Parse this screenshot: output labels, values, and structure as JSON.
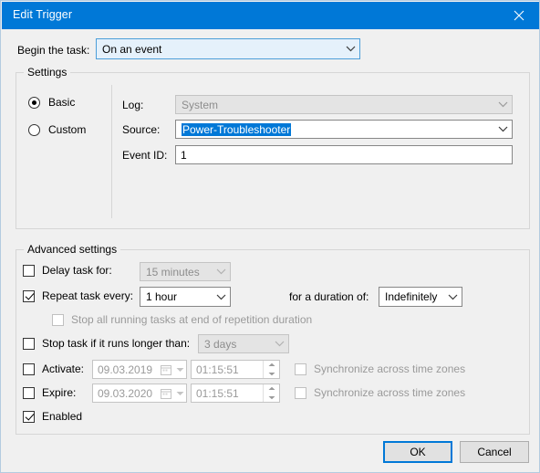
{
  "window": {
    "title": "Edit Trigger",
    "close_icon": "close-icon",
    "titlebar_color": "#0078d7"
  },
  "begin": {
    "label": "Begin the task:",
    "value": "On an event"
  },
  "settings": {
    "group_title": "Settings",
    "radios": [
      {
        "label": "Basic",
        "checked": true
      },
      {
        "label": "Custom",
        "checked": false
      }
    ],
    "fields": {
      "log_label": "Log:",
      "log_value": "System",
      "source_label": "Source:",
      "source_value": "Power-Troubleshooter",
      "eventid_label": "Event ID:",
      "eventid_value": "1"
    }
  },
  "advanced": {
    "group_title": "Advanced settings",
    "delay": {
      "label": "Delay task for:",
      "checked": false,
      "value": "15 minutes"
    },
    "repeat": {
      "label": "Repeat task every:",
      "checked": true,
      "value": "1 hour",
      "duration_label": "for a duration of:",
      "duration_value": "Indefinitely"
    },
    "stop_all": {
      "label": "Stop all running tasks at end of repetition duration",
      "checked": false
    },
    "stop_longer": {
      "label": "Stop task if it runs longer than:",
      "checked": false,
      "value": "3 days"
    },
    "activate": {
      "label": "Activate:",
      "checked": false,
      "date": "09.03.2019",
      "time": "01:15:51",
      "sync_label": "Synchronize across time zones",
      "sync_checked": false
    },
    "expire": {
      "label": "Expire:",
      "checked": false,
      "date": "09.03.2020",
      "time": "01:15:51",
      "sync_label": "Synchronize across time zones",
      "sync_checked": false
    },
    "enabled": {
      "label": "Enabled",
      "checked": true
    }
  },
  "footer": {
    "ok_label": "OK",
    "cancel_label": "Cancel",
    "accent_color": "#0078d7"
  }
}
